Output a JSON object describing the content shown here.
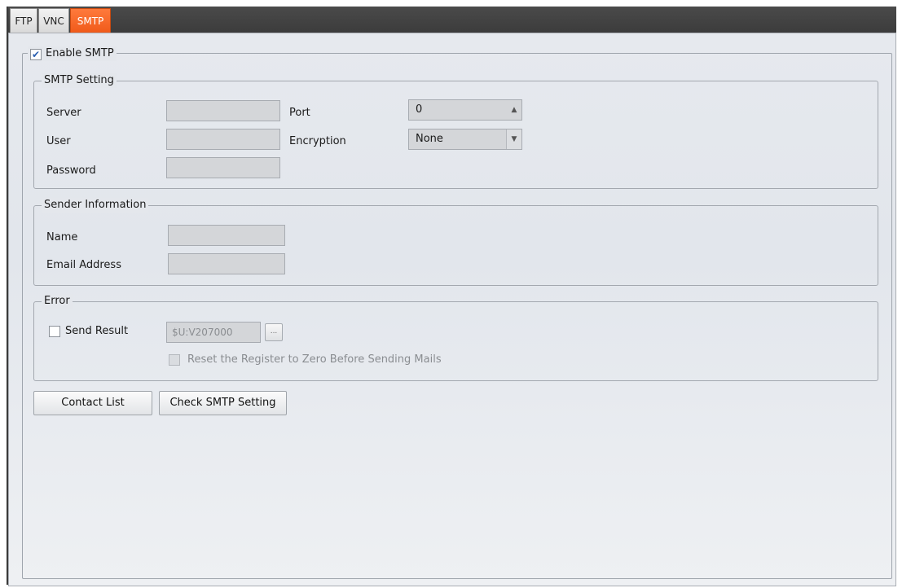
{
  "tabs": [
    {
      "label": "FTP"
    },
    {
      "label": "VNC"
    },
    {
      "label": "SMTP"
    }
  ],
  "enable_smtp": {
    "label": "Enable SMTP",
    "checked": true
  },
  "smtp_setting": {
    "legend": "SMTP Setting",
    "server_label": "Server",
    "server_value": "",
    "user_label": "User",
    "user_value": "",
    "password_label": "Password",
    "password_value": "",
    "port_label": "Port",
    "port_value": "0",
    "encryption_label": "Encryption",
    "encryption_value": "None"
  },
  "sender": {
    "legend": "Sender Information",
    "name_label": "Name",
    "name_value": "",
    "email_label": "Email Address",
    "email_value": ""
  },
  "error": {
    "legend": "Error",
    "send_result_label": "Send Result",
    "register_value": "$U:V207000",
    "browse_label": "...",
    "reset_label": "Reset the Register to Zero Before Sending Mails"
  },
  "buttons": {
    "contact_list": "Contact List",
    "check_smtp": "Check SMTP Setting"
  },
  "icons": {
    "checkmark": "✔",
    "spin_up": "▲",
    "dropdown": "▼"
  },
  "colors": {
    "active_tab": "#f05a1a",
    "panel": "#e4e7ec",
    "tab_strip": "#3c3c3c"
  }
}
